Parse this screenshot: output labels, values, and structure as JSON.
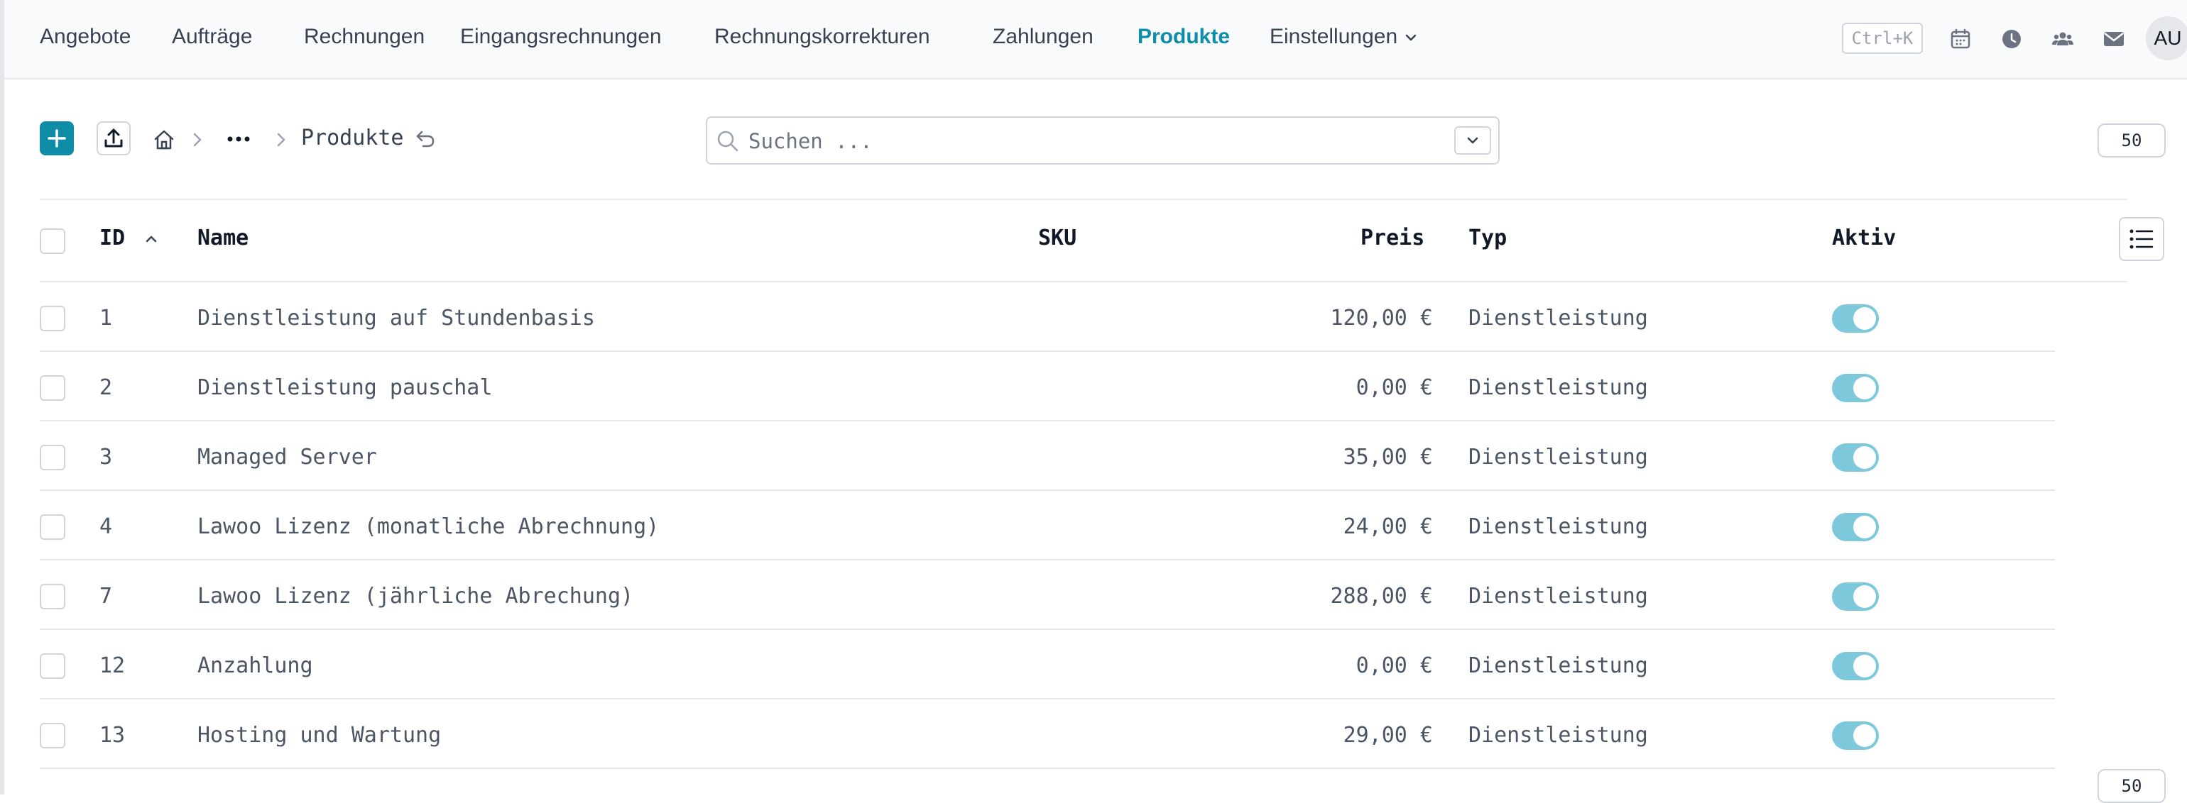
{
  "nav": {
    "items": [
      "Angebote",
      "Aufträge",
      "Rechnungen",
      "Eingangsrechnungen",
      "Rechnungskorrekturen",
      "Zahlungen",
      "Produkte",
      "Einstellungen"
    ],
    "active": "Produkte"
  },
  "shortcut": "Ctrl+K",
  "user": {
    "initials": "AU"
  },
  "toolbar": {
    "add_icon": "plus-icon",
    "upload_icon": "upload-icon",
    "breadcrumb": {
      "home_icon": "home-icon",
      "more_icon": "ellipsis-icon",
      "current": "Produkte",
      "back_icon": "undo-icon"
    }
  },
  "search": {
    "placeholder": "Suchen ...",
    "value": ""
  },
  "per_page": "50",
  "table": {
    "headers": {
      "id": "ID",
      "name": "Name",
      "sku": "SKU",
      "price": "Preis",
      "type": "Typ",
      "active": "Aktiv"
    },
    "sort": {
      "column": "ID",
      "direction": "asc"
    },
    "rows": [
      {
        "id": "1",
        "name": "Dienstleistung auf Stundenbasis",
        "sku": "",
        "price": "120,00 €",
        "type": "Dienstleistung",
        "active": true
      },
      {
        "id": "2",
        "name": "Dienstleistung pauschal",
        "sku": "",
        "price": "0,00 €",
        "type": "Dienstleistung",
        "active": true
      },
      {
        "id": "3",
        "name": "Managed Server",
        "sku": "",
        "price": "35,00 €",
        "type": "Dienstleistung",
        "active": true
      },
      {
        "id": "4",
        "name": "Lawoo Lizenz (monatliche Abrechnung)",
        "sku": "",
        "price": "24,00 €",
        "type": "Dienstleistung",
        "active": true
      },
      {
        "id": "7",
        "name": "Lawoo Lizenz (jährliche Abrechung)",
        "sku": "",
        "price": "288,00 €",
        "type": "Dienstleistung",
        "active": true
      },
      {
        "id": "12",
        "name": "Anzahlung",
        "sku": "",
        "price": "0,00 €",
        "type": "Dienstleistung",
        "active": true
      },
      {
        "id": "13",
        "name": "Hosting und Wartung",
        "sku": "",
        "price": "29,00 €",
        "type": "Dienstleistung",
        "active": true
      }
    ]
  },
  "colors": {
    "accent": "#0e8ca8",
    "toggle_on": "#7ec8dc",
    "border": "#e5e7eb"
  }
}
